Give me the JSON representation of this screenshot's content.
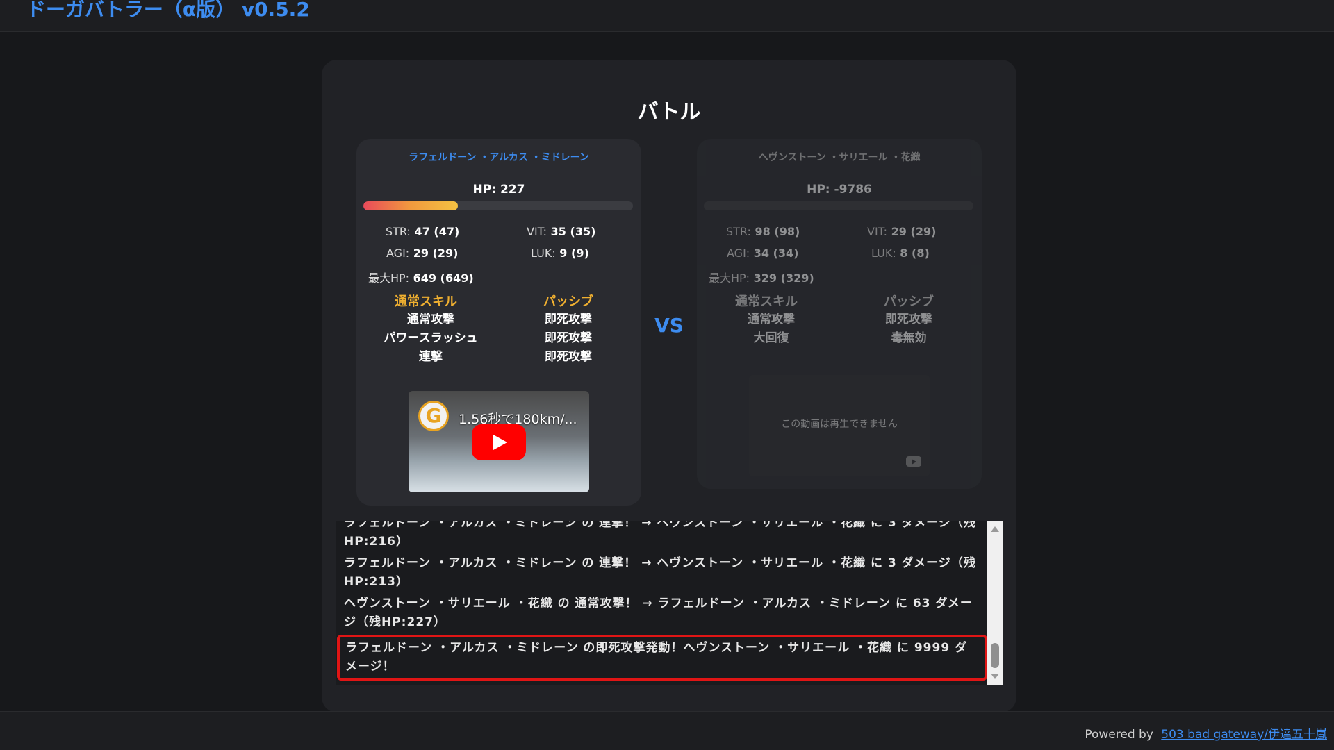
{
  "app": {
    "title": "ドーガバトラー（α版） v0.5.2"
  },
  "battle": {
    "title": "バトル",
    "vs": "VS"
  },
  "player1": {
    "name": "ラフェルドーン ・アルカス ・ミドレーン",
    "hp_label": "HP:",
    "hp": "227",
    "hp_fraction": 0.35,
    "stats": {
      "str_label": "STR:",
      "str": "47",
      "str_base": "(47)",
      "vit_label": "VIT:",
      "vit": "35",
      "vit_base": "(35)",
      "agi_label": "AGI:",
      "agi": "29",
      "agi_base": "(29)",
      "luk_label": "LUK:",
      "luk": "9",
      "luk_base": "(9)",
      "maxhp_label": "最大HP:",
      "maxhp": "649",
      "maxhp_base": "(649)"
    },
    "normal_skill_header": "通常スキル",
    "passive_header": "パッシブ",
    "normal_skills": [
      "通常攻撃",
      "パワースラッシュ",
      "連撃"
    ],
    "passives": [
      "即死攻撃",
      "即死攻撃",
      "即死攻撃"
    ],
    "video": {
      "title": "1.56秒で180km/...",
      "channel_icon": "G"
    }
  },
  "player2": {
    "name": "ヘヴンストーン ・サリエール ・花織",
    "hp_label": "HP:",
    "hp": "-9786",
    "hp_fraction": 0,
    "stats": {
      "str_label": "STR:",
      "str": "98",
      "str_base": "(98)",
      "vit_label": "VIT:",
      "vit": "29",
      "vit_base": "(29)",
      "agi_label": "AGI:",
      "agi": "34",
      "agi_base": "(34)",
      "luk_label": "LUK:",
      "luk": "8",
      "luk_base": "(8)",
      "maxhp_label": "最大HP:",
      "maxhp": "329",
      "maxhp_base": "(329)"
    },
    "normal_skill_header": "通常スキル",
    "passive_header": "パッシブ",
    "normal_skills": [
      "通常攻撃",
      "大回復"
    ],
    "passives": [
      "即死攻撃",
      "毒無効"
    ],
    "video": {
      "unavailable_text": "この動画は再生できません"
    }
  },
  "log": [
    "ラフェルドーン ・アルカス ・ミドレーン の 連撃！ → ヘヴンストーン ・サリエール ・花織 に 3 ダメージ（残HP:216）",
    "ラフェルドーン ・アルカス ・ミドレーン の 連撃！ → ヘヴンストーン ・サリエール ・花織 に 3 ダメージ（残HP:213）",
    "ヘヴンストーン ・サリエール ・花織 の 通常攻撃！ → ラフェルドーン ・アルカス ・ミドレーン に 63 ダメージ（残HP:227）",
    "ラフェルドーン ・アルカス ・ミドレーン の即死攻撃発動！ヘヴンストーン ・サリエール ・花織 に 9999 ダメージ！"
  ],
  "footer": {
    "powered_by": "Powered by",
    "link_text": "503 bad gateway/伊達五十嵐"
  },
  "colors": {
    "accent": "#3d8cf0",
    "skill_header": "#f0b030",
    "highlight": "#e01515"
  }
}
